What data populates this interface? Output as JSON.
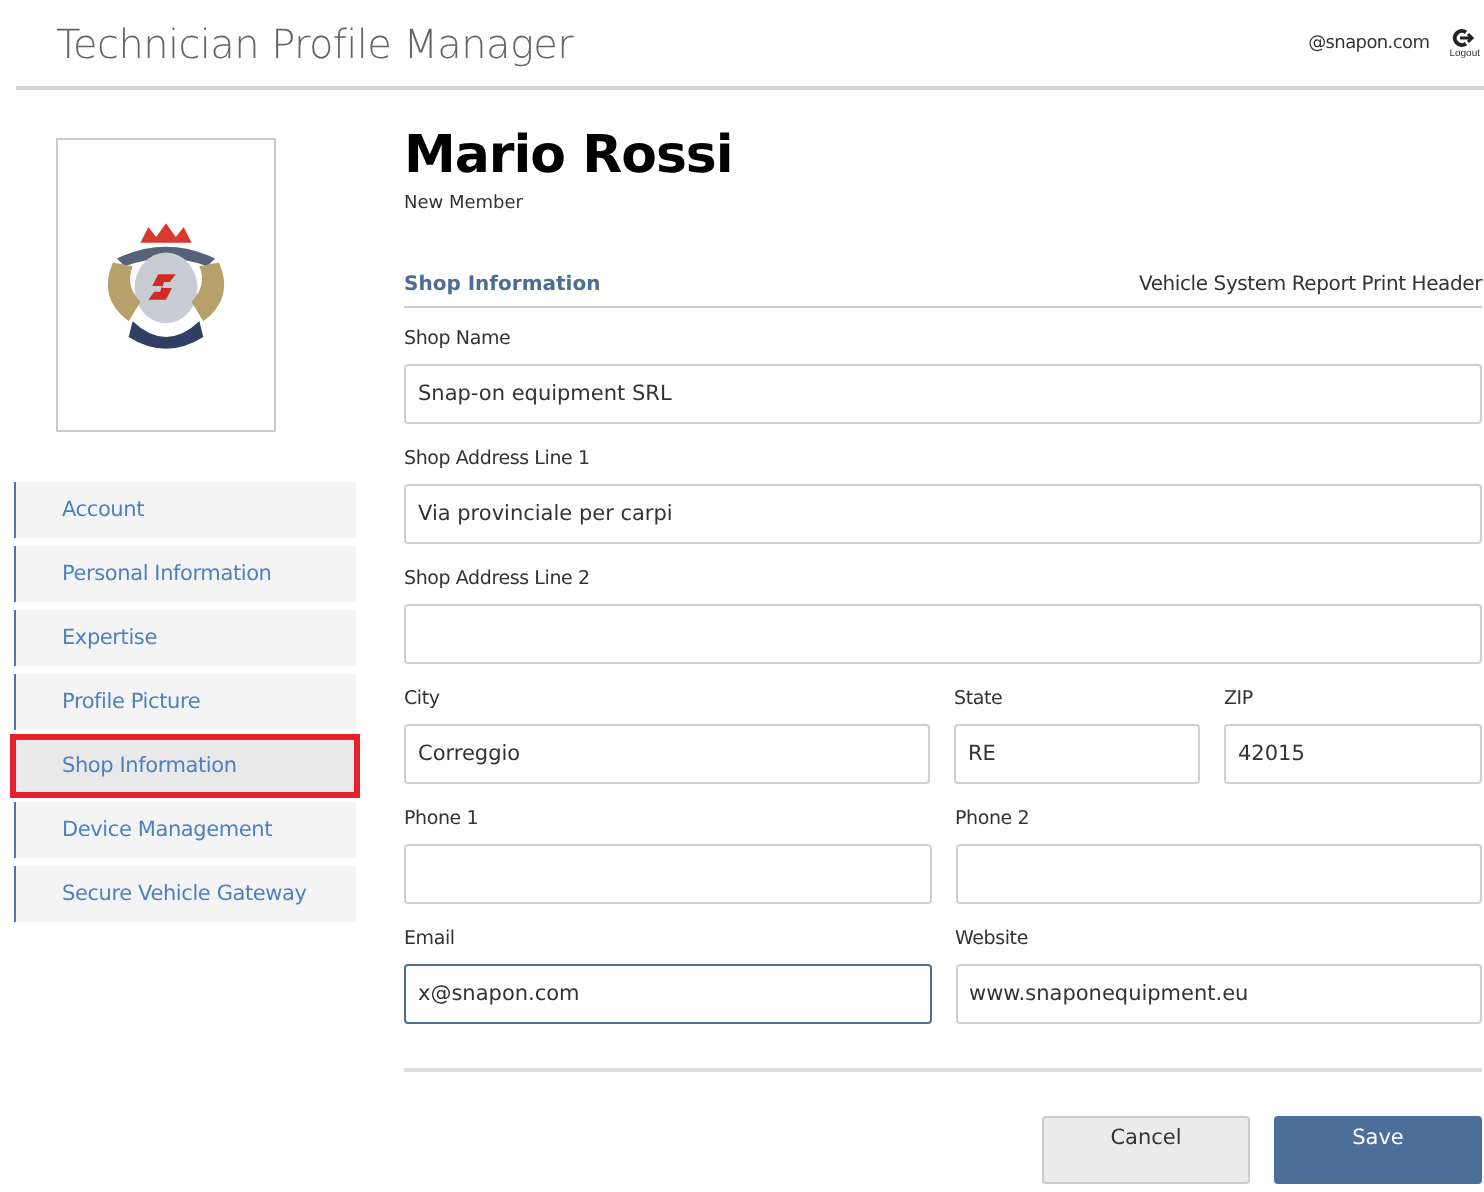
{
  "header": {
    "title": "Technician Profile Manager",
    "user": "@snapon.com",
    "logout": "Logout"
  },
  "profile": {
    "picture": {
      "kind": "picture"
    }
  },
  "nav": [
    {
      "label": "Account",
      "selected": false
    },
    {
      "label": "Personal Information",
      "selected": false
    },
    {
      "label": "Expertise",
      "selected": false
    },
    {
      "label": "Profile Picture",
      "selected": false
    },
    {
      "label": "Shop Information",
      "selected": true
    },
    {
      "label": "Device Management",
      "selected": false
    },
    {
      "label": "Secure Vehicle Gateway",
      "selected": false
    }
  ],
  "member": {
    "name": "Mario Rossi",
    "status": "New Member"
  },
  "section": {
    "title": "Shop Information",
    "link": "Vehicle System Report Print Header"
  },
  "form_rows": [
    [
      {
        "label": "Shop Name",
        "value": "Snap-on equipment SRL",
        "focused": false
      }
    ],
    [
      {
        "label": "Shop Address Line 1",
        "value": "Via provinciale per carpi",
        "focused": false
      }
    ],
    [
      {
        "label": "Shop Address Line 2",
        "focused": false
      }
    ],
    [
      {
        "label": "City",
        "value": "Correggio",
        "focused": false
      },
      {
        "label": "State",
        "value": "RE",
        "focused": false
      },
      {
        "label": "ZIP",
        "value": "42015",
        "focused": false
      }
    ],
    [
      {
        "label": "Phone 1",
        "focused": false
      },
      {
        "label": "Phone 2",
        "focused": false
      }
    ],
    [
      {
        "label": "Email",
        "value": "x@snapon.com",
        "focused": true
      },
      {
        "label": "Website",
        "value": "www.snaponequipment.eu",
        "focused": false
      }
    ]
  ],
  "buttons": [
    {
      "label": "Cancel",
      "kind": "secondary"
    },
    {
      "label": "Save",
      "kind": "primary"
    }
  ]
}
